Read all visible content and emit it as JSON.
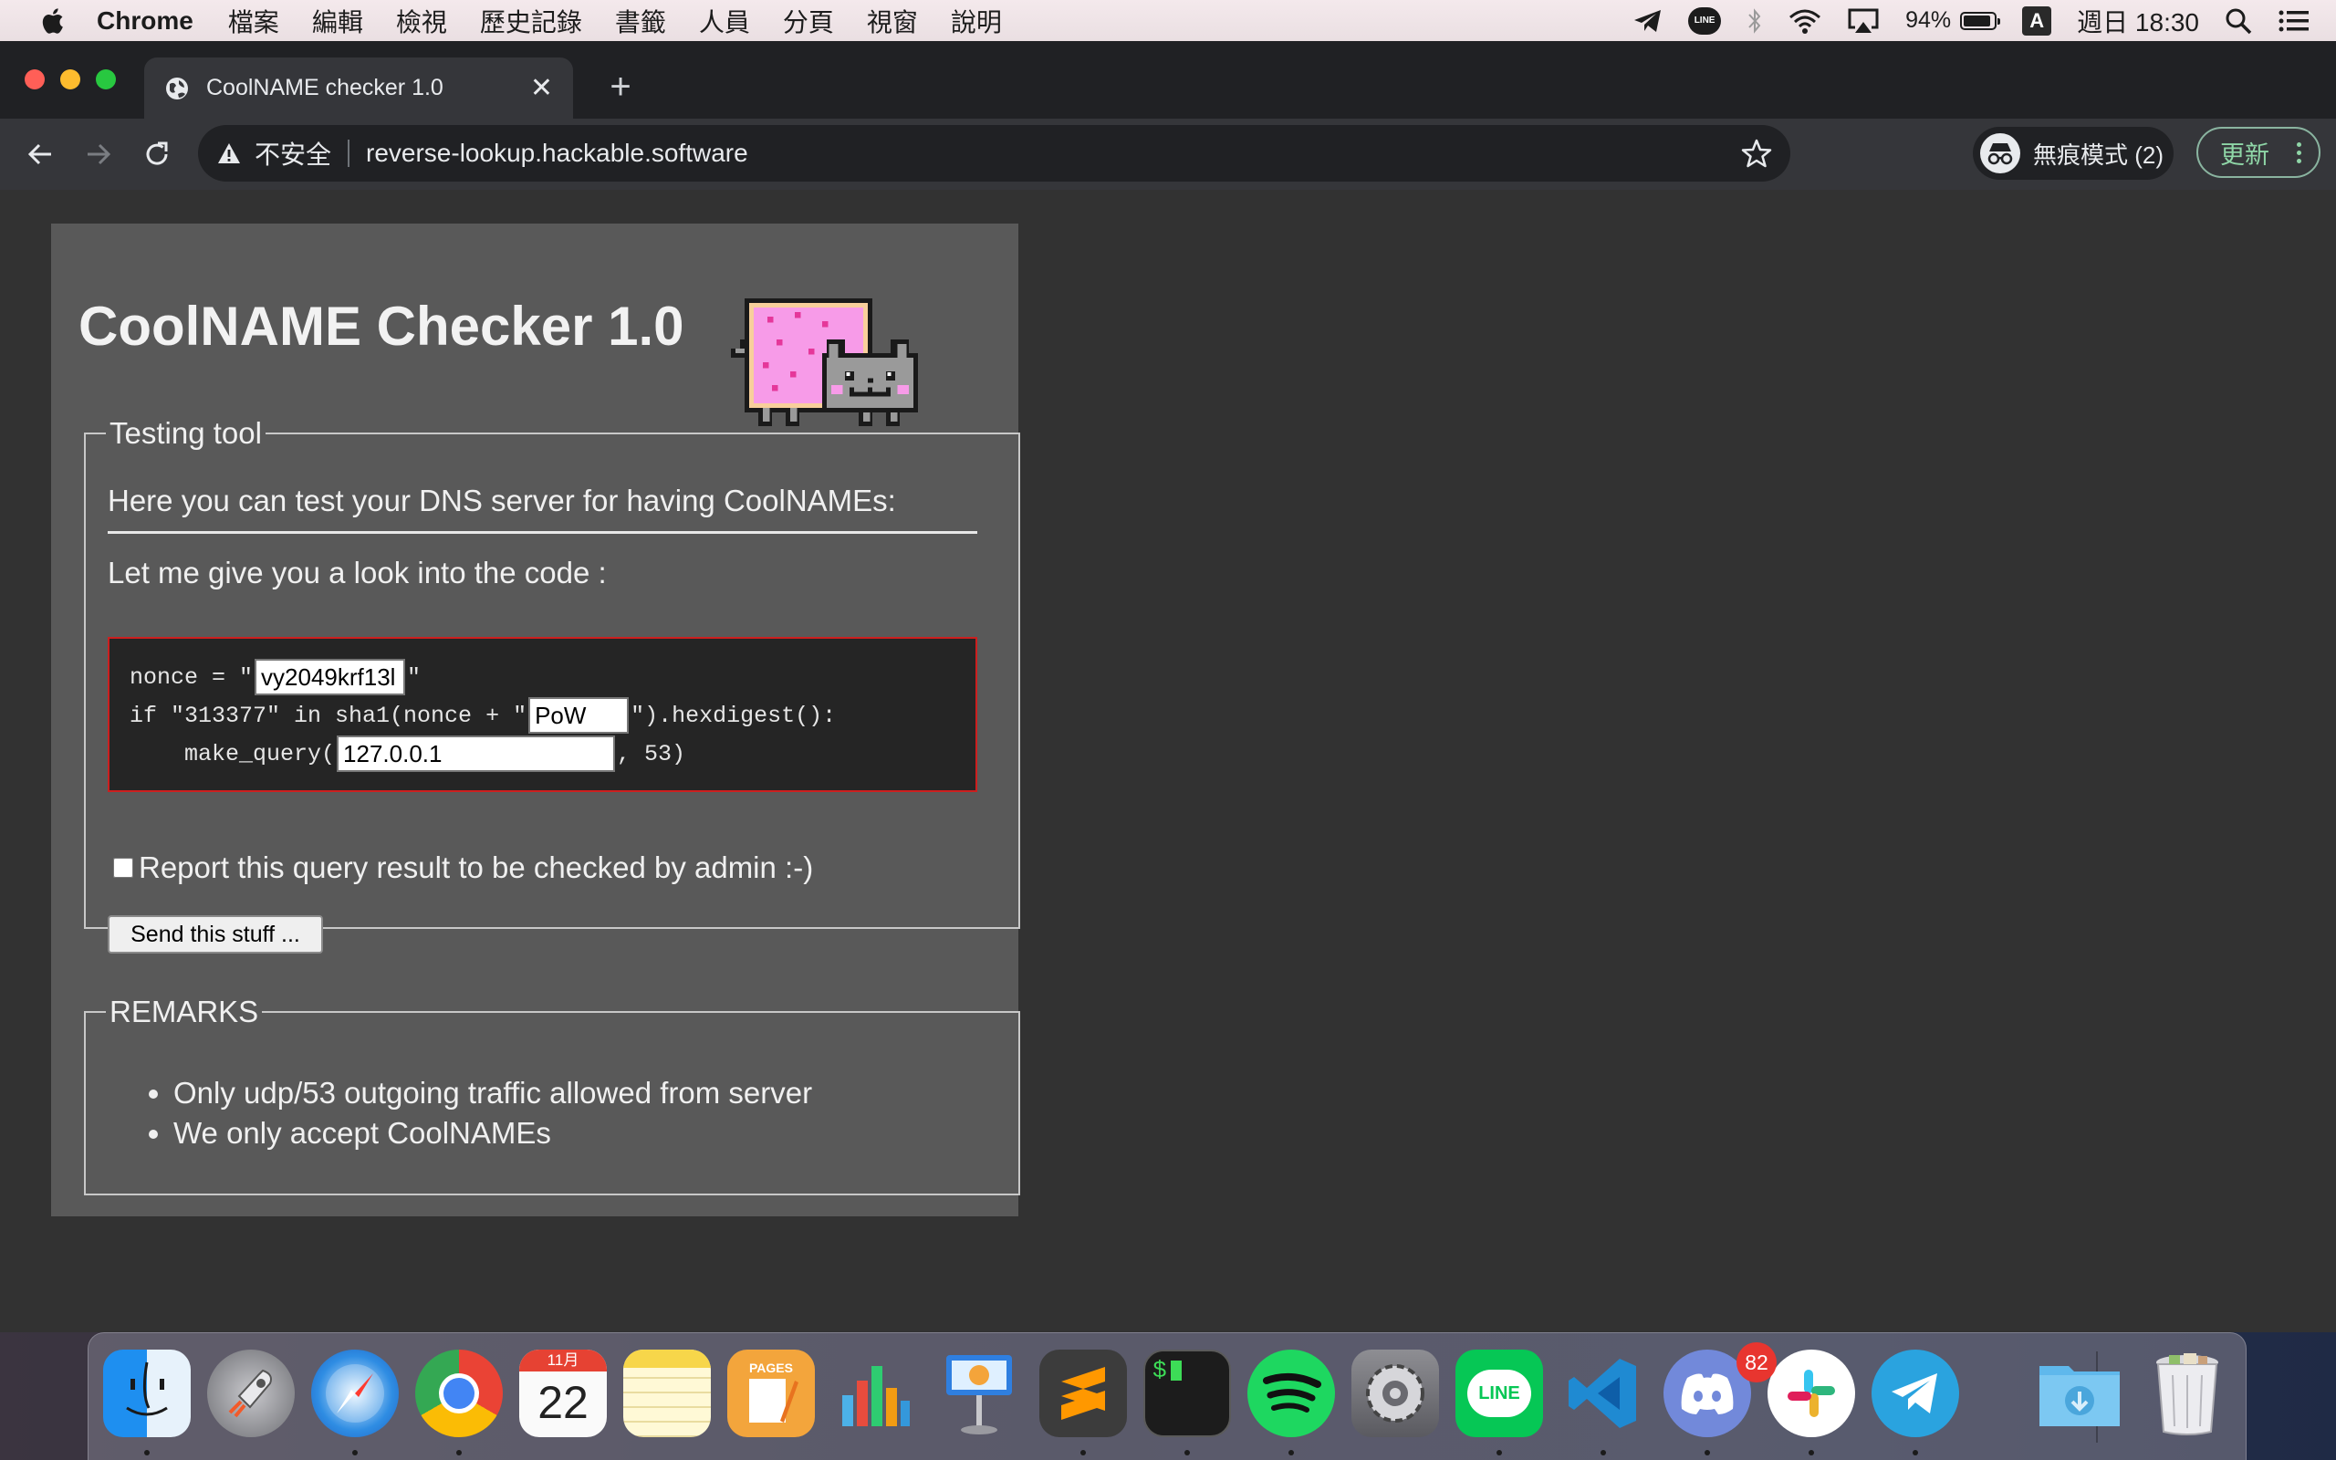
{
  "menubar": {
    "app_name": "Chrome",
    "menus": [
      "檔案",
      "編輯",
      "檢視",
      "歷史記錄",
      "書籤",
      "人員",
      "分頁",
      "視窗",
      "說明"
    ],
    "battery_percent": "94%",
    "battery_level": 0.94,
    "input_method": "A",
    "clock": "週日 18:30",
    "status_icons": [
      "telegram-icon",
      "line-icon",
      "bluetooth-icon",
      "wifi-icon",
      "airplay-icon",
      "battery-icon",
      "input-method-icon",
      "clock",
      "spotlight-icon",
      "notification-center-icon"
    ]
  },
  "browser": {
    "tab_title": "CoolNAME checker 1.0",
    "new_tab_label": "+",
    "security_label": "不安全",
    "url": "reverse-lookup.hackable.software",
    "incognito_label": "無痕模式 (2)",
    "update_label": "更新"
  },
  "page": {
    "heading": "CoolNAME Checker 1.0",
    "testing_legend": "Testing tool",
    "intro_text": "Here you can test your DNS server for having CoolNAMEs:",
    "look_text": "Let me give you a look into the code :",
    "code": {
      "line1_prefix": "nonce = \"",
      "nonce_value": "vy2049krf13l",
      "line1_suffix": "\"",
      "line2_prefix": "if \"313377\" in sha1(nonce + \"",
      "pow_value": "PoW",
      "line2_suffix": "\").hexdigest():",
      "line3_prefix": "    make_query(",
      "query_value": "127.0.0.1",
      "line3_suffix": ", 53)"
    },
    "report_label": "Report this query result to be checked by admin :-)",
    "report_checked": false,
    "send_button": "Send this stuff ...",
    "remarks_legend": "REMARKS",
    "remarks": [
      "Only udp/53 outgoing traffic allowed from server",
      "We only accept CoolNAMEs"
    ]
  },
  "dock": {
    "apps": [
      "finder-icon",
      "launchpad-icon",
      "safari-icon",
      "chrome-icon",
      "calendar-icon",
      "notes-icon",
      "pages-icon",
      "numbers-icon",
      "keynote-icon",
      "sublime-text-icon",
      "terminal-icon",
      "spotify-icon",
      "system-preferences-icon",
      "line-icon",
      "vscode-icon",
      "discord-icon",
      "slack-icon",
      "telegram-icon",
      "downloads-folder-icon",
      "trash-icon"
    ],
    "calendar_month": "11月",
    "calendar_day": "22",
    "discord_badge": "82",
    "pages_label": "PAGES",
    "terminal_prompt": "$"
  },
  "colors": {
    "page_background": "#323232",
    "card_background": "#595959",
    "code_border": "#cc1f1f",
    "update_accent": "#8fd6a7"
  }
}
